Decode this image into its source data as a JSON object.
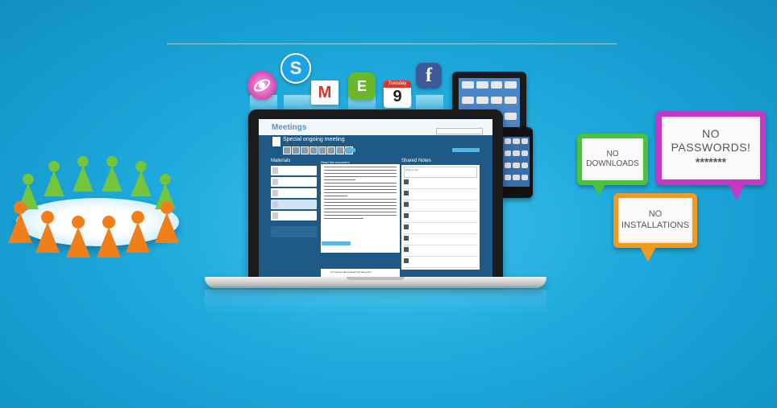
{
  "bubbles": {
    "downloads": "NO\nDOWNLOADS",
    "passwords": "NO\nPASSWORDS!",
    "passwords_mask": "*******",
    "installations": "NO\nINSTALLATIONS"
  },
  "icons": {
    "skype": "S",
    "gmail": "M",
    "evernote": "E",
    "calendar_day": "9",
    "calendar_month": "Tuesday",
    "facebook": "f"
  },
  "screen": {
    "logo": "Meetin",
    "logo_suffix": "gs",
    "meeting_title": "Special ongoing meeting",
    "materials_header": "Materials",
    "document_header": "Read this document",
    "notes_header": "Shared Notes",
    "notes_input": "Write a note...",
    "leave_comment": "Leave a comment",
    "comment_text": "A comment about Read this document"
  },
  "colors": {
    "bubble_downloads": "#4cc23c",
    "bubble_passwords": "#c437c8",
    "bubble_installations": "#f39a1e",
    "people_green": "#74c53a",
    "people_orange": "#f07f1a"
  }
}
